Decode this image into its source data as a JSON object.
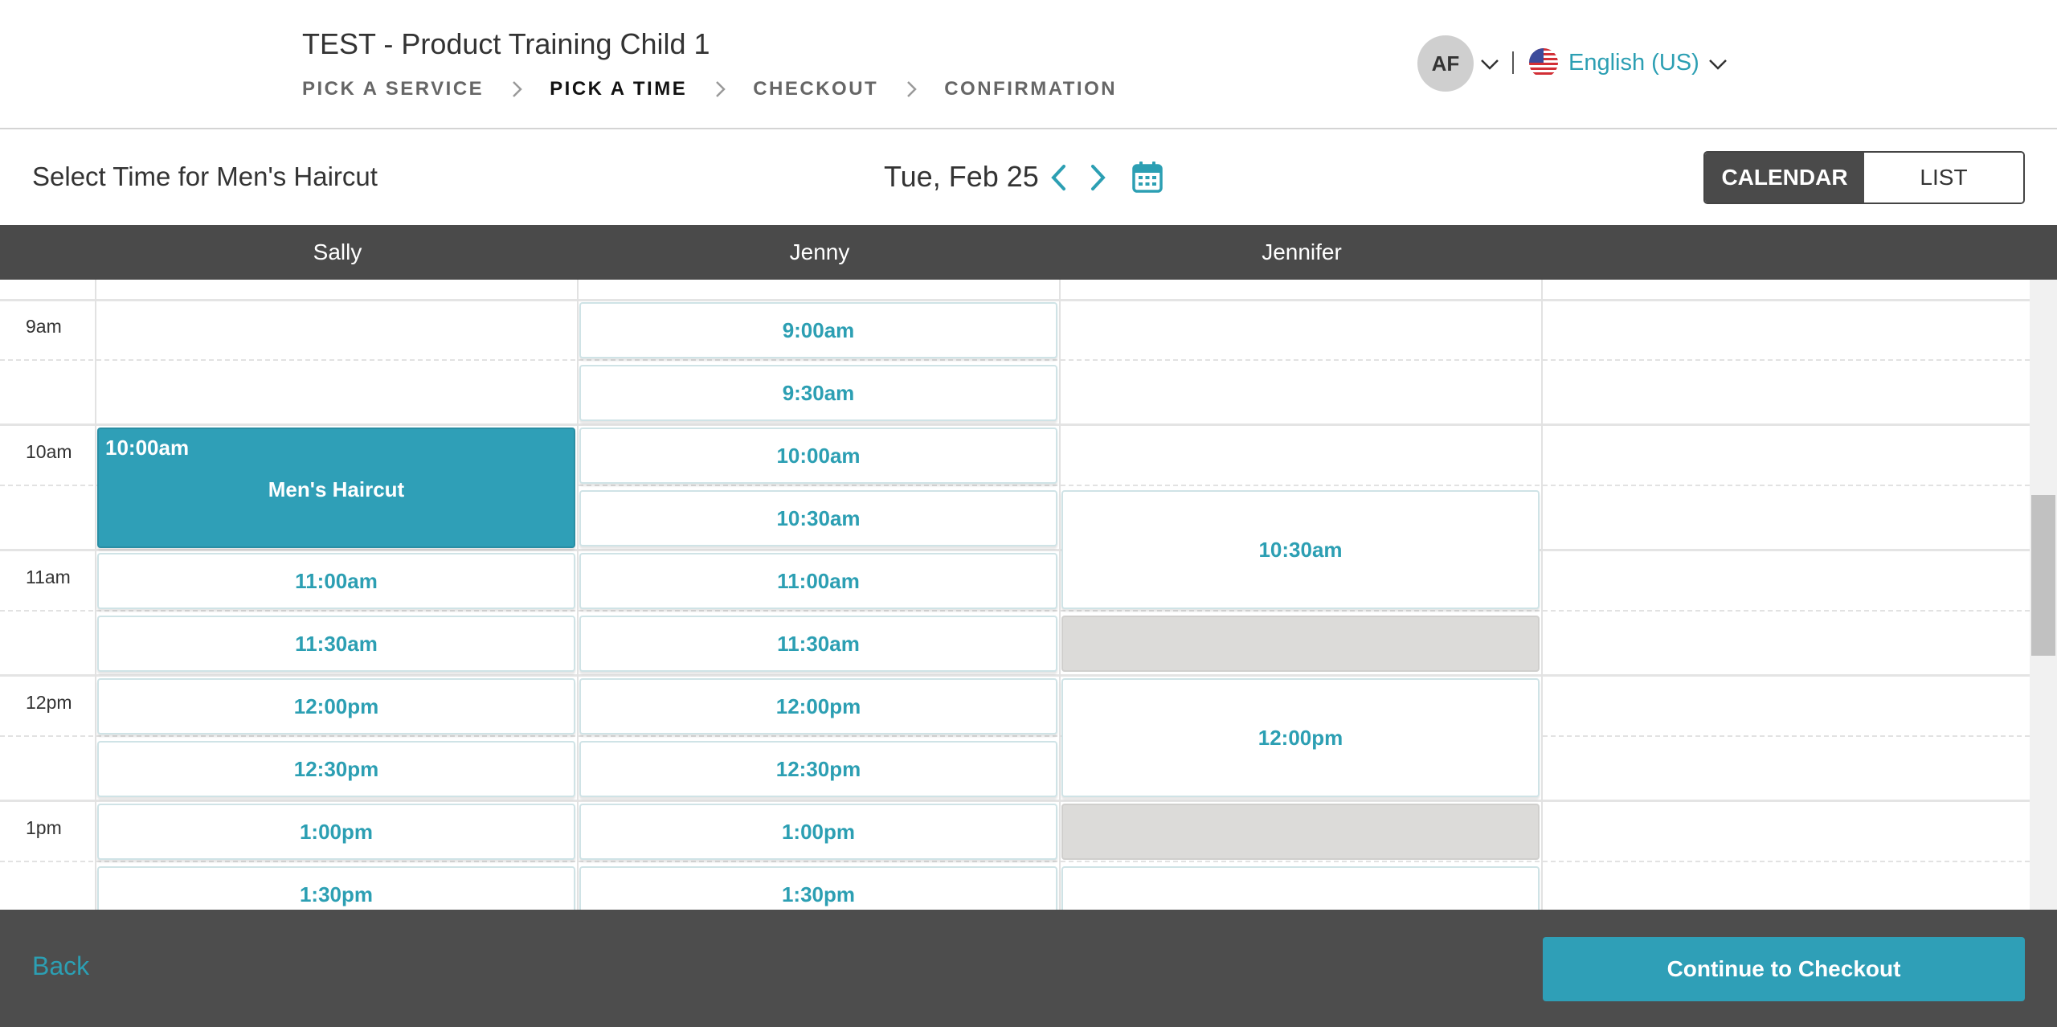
{
  "header": {
    "site_title": "TEST - Product Training Child 1",
    "steps": [
      "PICK A SERVICE",
      "PICK A TIME",
      "CHECKOUT",
      "CONFIRMATION"
    ],
    "active_step": "PICK A TIME",
    "user_initials": "AF",
    "language": "English (US)"
  },
  "toolbar": {
    "select_title": "Select Time for Men's Haircut",
    "date_label": "Tue, Feb 25",
    "views": [
      "CALENDAR",
      "LIST"
    ],
    "active_view": "CALENDAR"
  },
  "staff": [
    "Sally",
    "Jenny",
    "Jennifer"
  ],
  "hours": [
    "9am",
    "10am",
    "11am",
    "12pm",
    "1pm"
  ],
  "slots": {
    "sally": [
      "11:00am",
      "11:30am",
      "12:00pm",
      "12:30pm",
      "1:00pm",
      "1:30pm"
    ],
    "jenny": [
      "9:00am",
      "9:30am",
      "10:00am",
      "10:30am",
      "11:00am",
      "11:30am",
      "12:00pm",
      "12:30pm",
      "1:00pm",
      "1:30pm"
    ],
    "jennifer": [
      "10:30am",
      "12:00pm"
    ]
  },
  "selected": {
    "time": "10:00am",
    "service": "Men's Haircut"
  },
  "footer": {
    "back_label": "Back",
    "continue_label": "Continue to Checkout"
  },
  "colors": {
    "accent": "#2f9fb7",
    "dark": "#4a4a4a",
    "unavailable": "#dcdbd9"
  },
  "icons": [
    "chevron-right-icon",
    "chevron-down-icon",
    "us-flag-icon",
    "chevron-left-icon",
    "calendar-icon"
  ]
}
